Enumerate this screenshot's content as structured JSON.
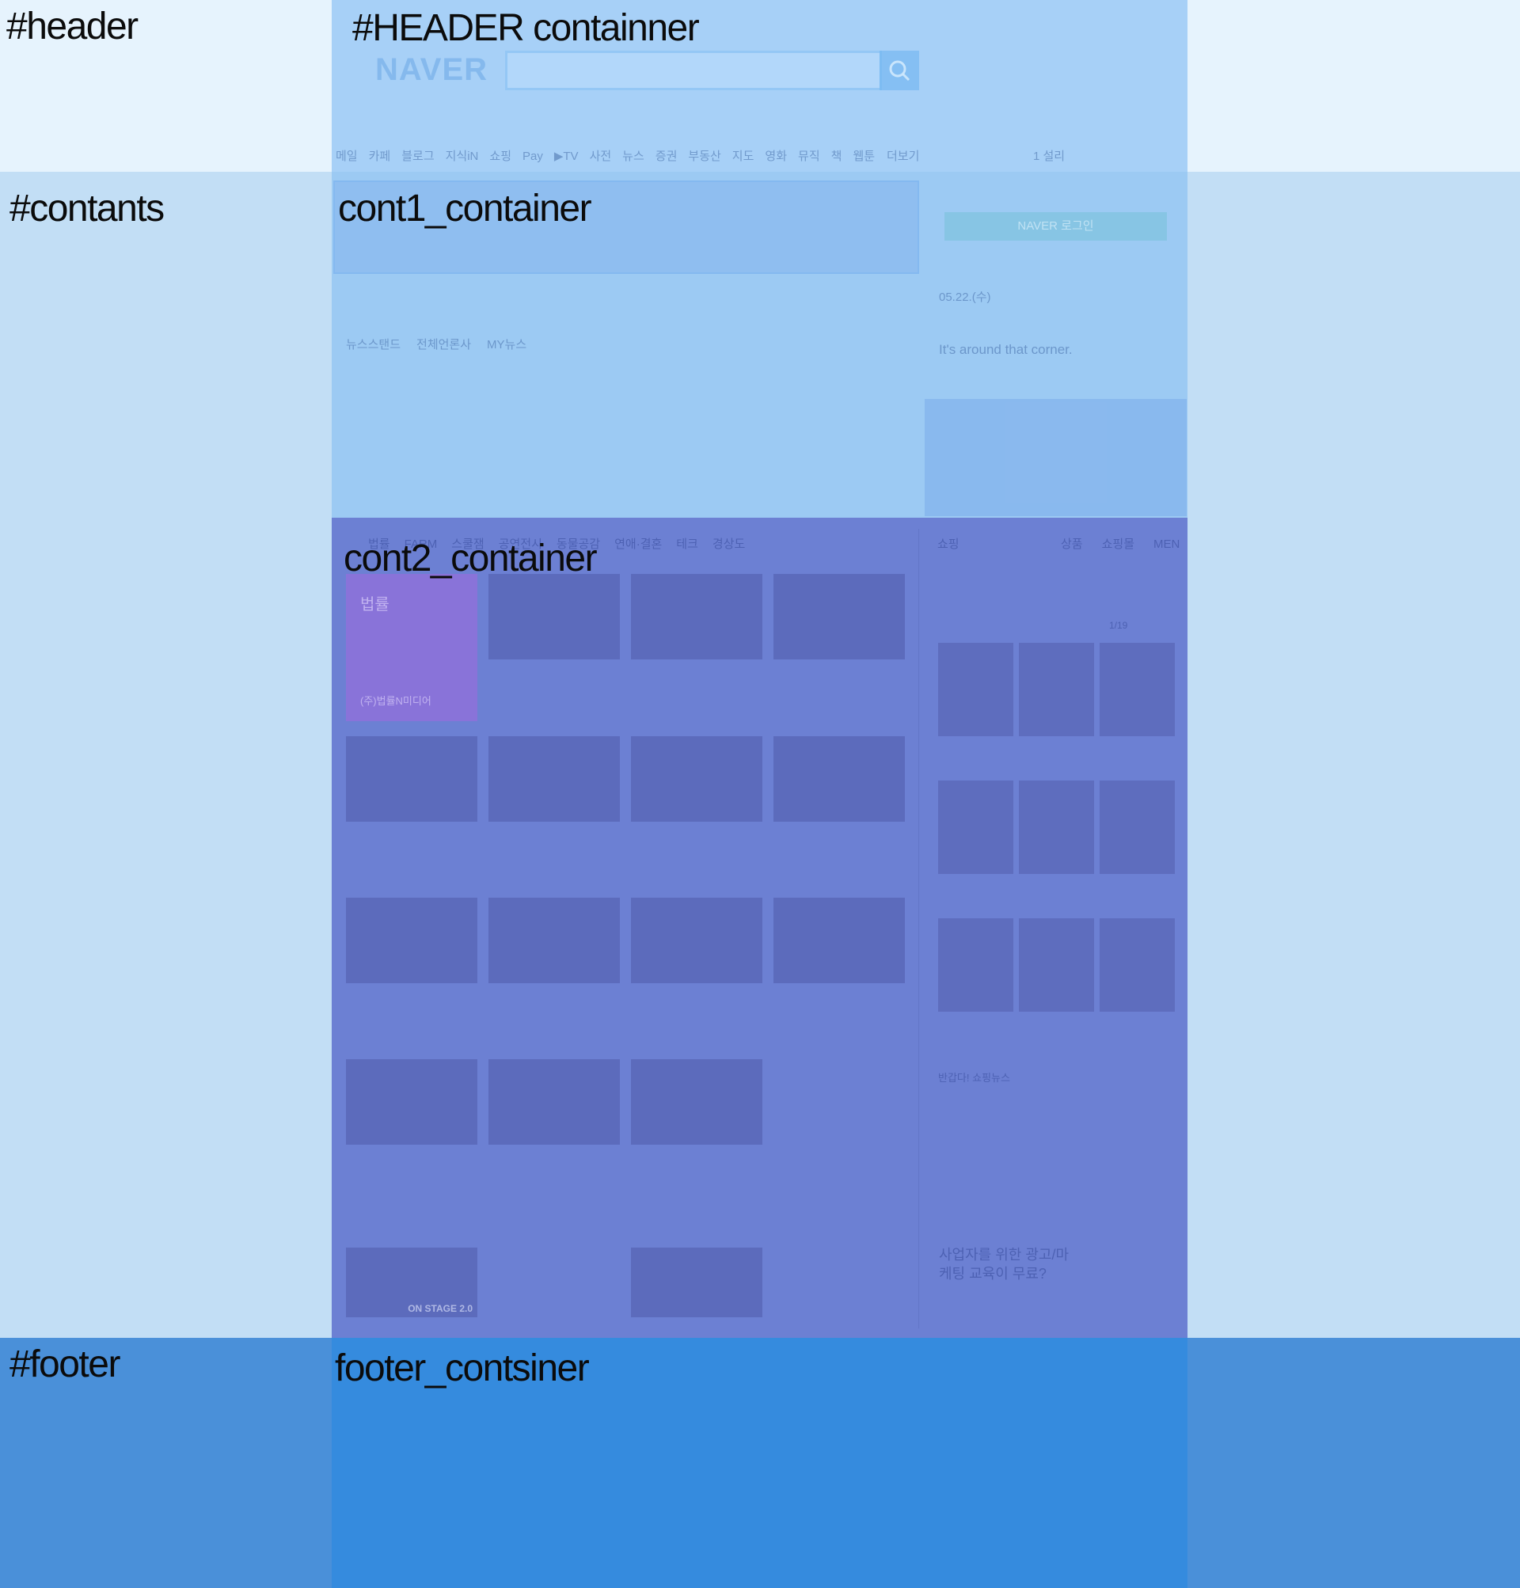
{
  "regions": {
    "header": "#header",
    "header_container": "#HEADER containner",
    "contents": "#contants",
    "cont1": "cont1_container",
    "cont2": "cont2_container",
    "footer": "#footer",
    "footer_container": "footer_contsiner"
  },
  "colors": {
    "header_band": "#e6f3fd",
    "contents_band": "#c2def5",
    "footer_band": "#4a90d9",
    "header_container": "#a7d0f7",
    "cont1_container": "#9ccaf3",
    "cont2_container": "#6c80d3",
    "footer_container": "#358bde"
  },
  "header": {
    "logo": "NAVER",
    "nav": [
      "메일",
      "카페",
      "블로그",
      "지식iN",
      "쇼핑",
      "Pay",
      "▶TV",
      "사전",
      "뉴스",
      "증권",
      "부동산",
      "지도",
      "영화",
      "뮤직",
      "책",
      "웹툰"
    ],
    "more": "더보기",
    "weather": "1 설리"
  },
  "cont1": {
    "login_button": "NAVER 로그인",
    "date": "05.22.(수)",
    "phrase": "It's around that corner.",
    "news_tabs": [
      "뉴스스탠드",
      "전체언론사",
      "MY뉴스"
    ]
  },
  "cont2": {
    "topics": [
      "법률",
      "FARM",
      "스쿨잼",
      "공연전시",
      "동물공감",
      "연애·결혼",
      "테크",
      "경상도"
    ],
    "feature_title": "법률",
    "feature_sub": "(주)법률N미디어",
    "shopping_title": "쇼핑",
    "shopping_tabs": [
      "상품",
      "쇼핑몰",
      "MEN"
    ],
    "shopping_news": "반갑다! 쇼핑뉴스",
    "page_indicator": "1/19",
    "promo": "사업자를 위한 광고/마케팅 교육이 무료?",
    "onstage": "ON STAGE 2.0"
  }
}
